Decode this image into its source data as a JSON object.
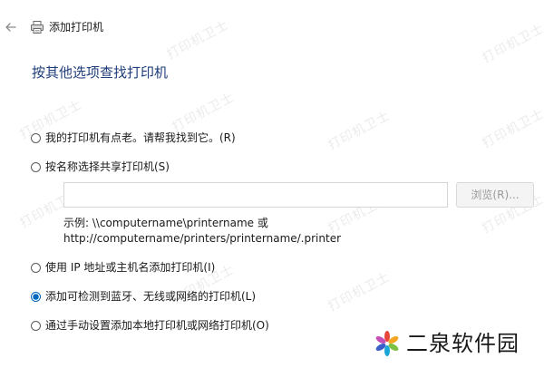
{
  "window": {
    "title": "添加打印机"
  },
  "heading": "按其他选项查找打印机",
  "options": [
    {
      "label": "我的打印机有点老。请帮我找到它。(R)",
      "checked": false
    },
    {
      "label": "按名称选择共享打印机(S)",
      "checked": false
    },
    {
      "label": "使用 IP 地址或主机名添加打印机(I)",
      "checked": false
    },
    {
      "label": "添加可检测到蓝牙、无线或网络的打印机(L)",
      "checked": true
    },
    {
      "label": "通过手动设置添加本地打印机或网络打印机(O)",
      "checked": false
    }
  ],
  "share_input": {
    "value": ""
  },
  "browse_button": {
    "label": "浏览(R)..."
  },
  "example": {
    "line1": "示例: \\\\computername\\printername 或",
    "line2": "http://computername/printers/printername/.printer"
  },
  "watermark": {
    "text": "打印机卫士"
  },
  "logo": {
    "text": "二泉软件园"
  },
  "colors": {
    "accent": "#0067c0",
    "heading": "#1f3d7a"
  }
}
